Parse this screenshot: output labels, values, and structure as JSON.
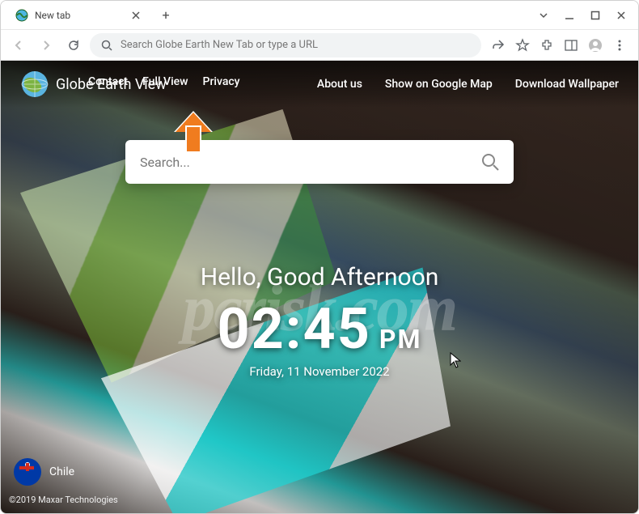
{
  "window": {
    "tab_title": "New tab",
    "omnibox_placeholder": "Search Globe Earth New Tab or type a URL"
  },
  "header": {
    "brand": "Globe Earth View",
    "links_left": [
      "Contact",
      "Full View",
      "Privacy"
    ],
    "links_right": [
      "About us",
      "Show on Google Map",
      "Download Wallpaper"
    ]
  },
  "search": {
    "placeholder": "Search..."
  },
  "greeting": {
    "text": "Hello, Good Afternoon",
    "time": "02:45",
    "ampm": "PM",
    "date": "Friday, 11 November 2022"
  },
  "location": {
    "name": "Chile"
  },
  "footer": {
    "copyright": "©2019 Maxar Technologies"
  },
  "watermark": "pcrisk.com"
}
